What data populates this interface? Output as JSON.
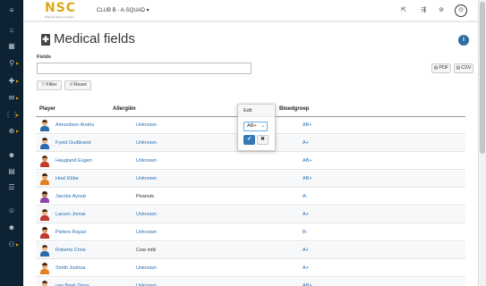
{
  "sidebar": {
    "toggle_icon": "≡",
    "items": [
      {
        "icon": "dashboard-icon",
        "glyph": "⌂",
        "caret": false
      },
      {
        "icon": "calendar-icon",
        "glyph": "▦",
        "caret": false
      },
      {
        "icon": "running-icon",
        "glyph": "⚲",
        "caret": true
      },
      {
        "icon": "medical-icon",
        "glyph": "✚",
        "caret": true
      },
      {
        "icon": "chat-icon",
        "glyph": "✉",
        "caret": true
      },
      {
        "icon": "analytics-icon",
        "glyph": "⋮⋮",
        "caret": true
      },
      {
        "icon": "strength-icon",
        "glyph": "⊕",
        "caret": true
      },
      {
        "icon": "users-icon",
        "glyph": "☻",
        "caret": false
      },
      {
        "icon": "grid-icon",
        "glyph": "▤",
        "caret": false
      },
      {
        "icon": "list-icon",
        "glyph": "☰",
        "caret": false
      },
      {
        "icon": "person-icon",
        "glyph": "☺",
        "caret": false
      },
      {
        "icon": "group-icon",
        "glyph": "☻",
        "caret": false
      },
      {
        "icon": "team-icon",
        "glyph": "⚇",
        "caret": true
      }
    ]
  },
  "topbar": {
    "logo_text": "NSC",
    "logo_subtext": "National Sports Contract",
    "club_selector": "CLUB B - A-SQUAD ▾",
    "icons": {
      "export": "⇱",
      "filter": "⇶",
      "link": "⊘"
    },
    "avatar_glyph": "⊙"
  },
  "page": {
    "title": "Medical fields",
    "title_icon": "✚",
    "info_icon": "i",
    "fields_label": "Fields",
    "fields_value": "",
    "buttons": {
      "filter": "Filter",
      "reset": "Reset",
      "pdf": "PDF",
      "csv": "CSV"
    }
  },
  "table": {
    "headers": [
      "Player",
      "Allergiën",
      "Bloedgroep"
    ],
    "rows": [
      {
        "name": "Amundsen Andris",
        "allergy": "Unknown",
        "blood": "AB+",
        "skin": "#e6b48a",
        "hair": "#4a2c17",
        "shirt": "#2b6cb0"
      },
      {
        "name": "Fyeld Gudbrand",
        "allergy": "Unknown",
        "blood": "A+",
        "skin": "#e8b990",
        "hair": "#3a2414",
        "shirt": "#2b6cb0"
      },
      {
        "name": "Haugland Eugen",
        "allergy": "Unknown",
        "blood": "AB+",
        "skin": "#d99a6c",
        "hair": "#5a3520",
        "shirt": "#c0392b"
      },
      {
        "name": "Hoel Ebbe",
        "allergy": "Unknown",
        "blood": "AB+",
        "skin": "#e3a873",
        "hair": "#3a2414",
        "shirt": "#e67e22"
      },
      {
        "name": "Jacobs Ayoub",
        "allergy": "Peanuts",
        "blood": "A-",
        "skin": "#b9804f",
        "hair": "#2b1a0e",
        "shirt": "#8e44ad"
      },
      {
        "name": "Larsen Jomar",
        "allergy": "Unknown",
        "blood": "A+",
        "skin": "#e6b48a",
        "hair": "#4a2c17",
        "shirt": "#c0392b"
      },
      {
        "name": "Pieters Rayan",
        "allergy": "Unknown",
        "blood": "B-",
        "skin": "#d99a6c",
        "hair": "#2b1a0e",
        "shirt": "#c0392b"
      },
      {
        "name": "Roberts Chris",
        "allergy": "Cow milk",
        "blood": "A+",
        "skin": "#e8b990",
        "hair": "#5a3520",
        "shirt": "#2b6cb0"
      },
      {
        "name": "Smith Joshua",
        "allergy": "Unknown",
        "blood": "A+",
        "skin": "#e3a873",
        "hair": "#3a2414",
        "shirt": "#e67e22"
      },
      {
        "name": "van Beek Dana",
        "allergy": "Unknown",
        "blood": "AB+",
        "skin": "#e6b48a",
        "hair": "#4a2c17",
        "shirt": "#2b6cb0"
      }
    ]
  },
  "popover": {
    "title": "Edit",
    "select_value": "AB+",
    "ok_glyph": "✔",
    "cancel_glyph": "✖"
  },
  "colors": {
    "sidebar_bg": "#0d2233",
    "link": "#2a6fb0",
    "primary_button": "#337ab7",
    "logo": "#d9a81b"
  }
}
